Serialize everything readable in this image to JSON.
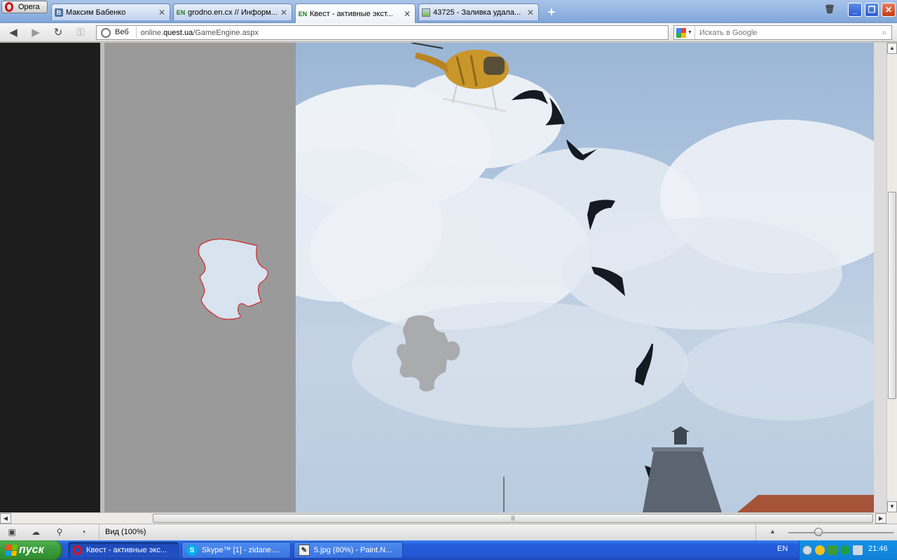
{
  "browser": {
    "menu_label": "Opera",
    "tabs": [
      {
        "title": "Максим Бабенко",
        "favicon": "vk-icon",
        "favicon_text": "В"
      },
      {
        "title": "grodno.en.cx // Информ...",
        "favicon": "en-icon",
        "favicon_text": "EN"
      },
      {
        "title": "Квест - активные экст...",
        "favicon": "en-icon",
        "favicon_text": "EN",
        "active": true
      },
      {
        "title": "43725 - Заливка удала...",
        "favicon": "image-icon",
        "favicon_text": ""
      }
    ],
    "new_tab_symbol": "+",
    "address": {
      "site_label": "Веб",
      "url_prefix": "online.",
      "url_domain": "quest.ua",
      "url_path": "/GameEngine.aspx"
    },
    "search": {
      "placeholder": "Искать в Google",
      "engine": "google-icon"
    }
  },
  "statusbar": {
    "zoom_label": "Вид (100%)",
    "zoom_percent": 100
  },
  "taskbar": {
    "start_label": "пуск",
    "tasks": [
      {
        "label": "Квест - активные экс...",
        "icon": "opera-icon",
        "active": true
      },
      {
        "label": "Skype™ [1] - zidane....",
        "icon": "skype-icon",
        "active": false
      },
      {
        "label": "5.jpg (80%) - Paint.N...",
        "icon": "paint-icon",
        "active": false
      }
    ],
    "language": "EN",
    "clock": "21:46"
  },
  "colors": {
    "gray_panel": "#9a9a9a",
    "dark_panel": "#1d1d1d",
    "puzzle_outline": "#d42a2a",
    "sky": "#aec4de"
  }
}
